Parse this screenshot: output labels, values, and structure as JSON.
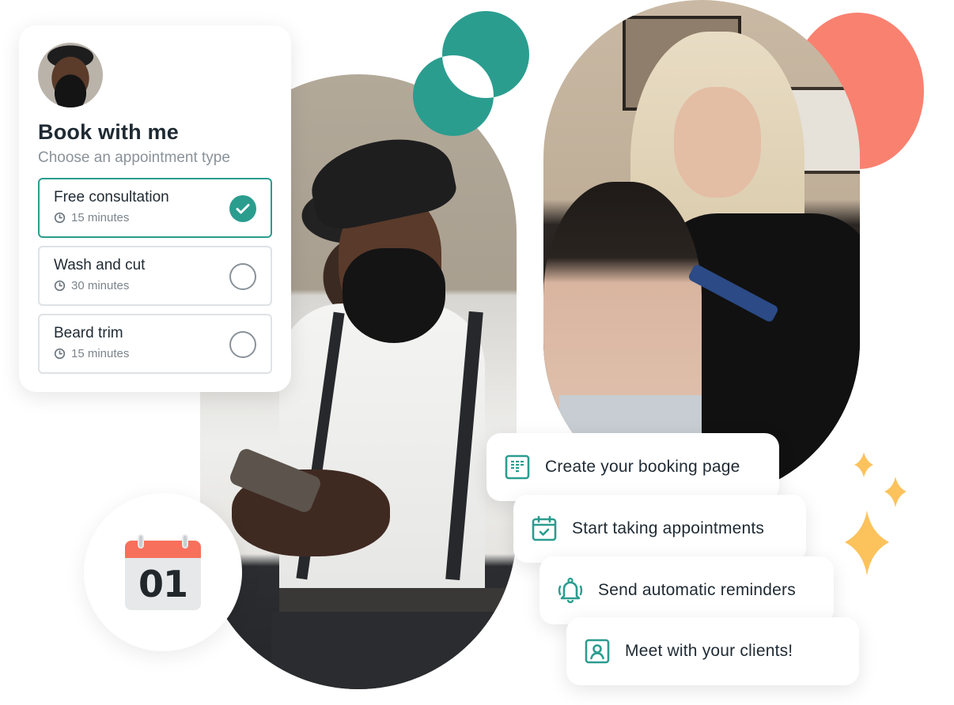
{
  "colors": {
    "accent": "#2a9d8f",
    "coral": "#f98170",
    "sparkle": "#fcc25c",
    "text_primary": "#1f2a33",
    "text_muted": "#8a9299",
    "calendar_header": "#f7705c"
  },
  "booking_card": {
    "avatar": "barber-profile-photo",
    "title": "Book with me",
    "subtitle": "Choose an appointment type",
    "options": [
      {
        "name": "Free consultation",
        "duration": "15 minutes",
        "selected": true,
        "icon": "clock-icon"
      },
      {
        "name": "Wash and cut",
        "duration": "30 minutes",
        "selected": false,
        "icon": "clock-icon"
      },
      {
        "name": "Beard trim",
        "duration": "15 minutes",
        "selected": false,
        "icon": "clock-icon"
      }
    ]
  },
  "calendar_badge": {
    "icon": "calendar-icon",
    "day": "01"
  },
  "photos": {
    "left": "barber-with-phone-photo",
    "right": "stylist-cutting-hair-photo"
  },
  "steps": [
    {
      "label": "Create your booking page",
      "icon": "booking-page-icon"
    },
    {
      "label": "Start taking appointments",
      "icon": "calendar-check-icon"
    },
    {
      "label": "Send automatic reminders",
      "icon": "bell-icon"
    },
    {
      "label": "Meet with your clients!",
      "icon": "client-contact-icon"
    }
  ],
  "decorations": [
    "teal-logo-circles",
    "coral-circle",
    "sparkles-icon"
  ]
}
